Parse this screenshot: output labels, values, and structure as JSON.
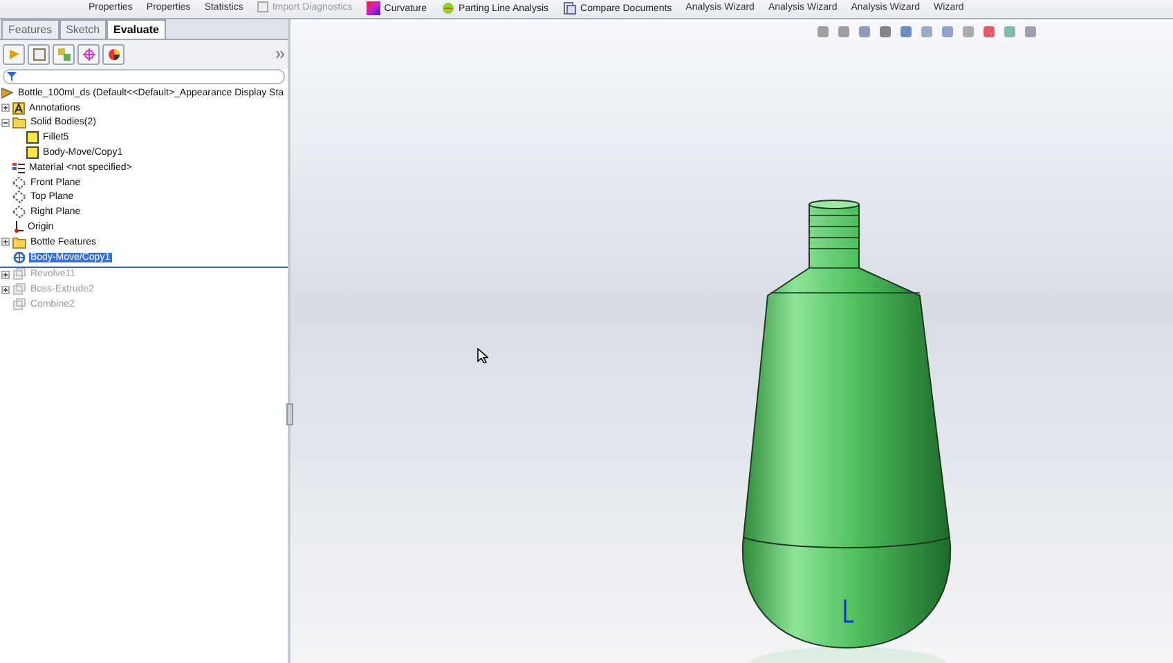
{
  "ribbon": {
    "items": [
      {
        "label": "Properties",
        "kind": "text"
      },
      {
        "label": "Properties",
        "kind": "text"
      },
      {
        "label": "Statistics",
        "kind": "text"
      },
      {
        "label": "Import Diagnostics",
        "kind": "tool",
        "disabled": true
      },
      {
        "label": "Curvature",
        "kind": "tool",
        "disabled": false
      },
      {
        "label": "Parting Line Analysis",
        "kind": "tool",
        "disabled": false
      },
      {
        "label": "Compare Documents",
        "kind": "tool",
        "disabled": false
      },
      {
        "label": "Analysis Wizard",
        "kind": "text"
      },
      {
        "label": "Analysis Wizard",
        "kind": "text"
      },
      {
        "label": "Analysis Wizard",
        "kind": "text"
      },
      {
        "label": "Wizard",
        "kind": "text"
      }
    ]
  },
  "tabs": [
    {
      "label": "Features",
      "selected": false
    },
    {
      "label": "Sketch",
      "selected": false
    },
    {
      "label": "Evaluate",
      "selected": true
    }
  ],
  "tree": {
    "root": "Bottle_100ml_ds  (Default<<Default>_Appearance Display Sta",
    "items": [
      {
        "label": "Annotations",
        "kind": "annotation",
        "expanded": false,
        "selected": false,
        "disabled": false
      },
      {
        "label": "Solid Bodies(2)",
        "kind": "folder",
        "expanded": true,
        "selected": false,
        "disabled": false,
        "children": [
          {
            "label": "Fillet5",
            "kind": "body",
            "selected": false,
            "disabled": false
          },
          {
            "label": "Body-Move/Copy1",
            "kind": "body",
            "selected": false,
            "disabled": false
          }
        ]
      },
      {
        "label": "Material <not specified>",
        "kind": "material",
        "selected": false,
        "disabled": false
      },
      {
        "label": "Front Plane",
        "kind": "plane",
        "selected": false,
        "disabled": false
      },
      {
        "label": "Top Plane",
        "kind": "plane",
        "selected": false,
        "disabled": false
      },
      {
        "label": "Right Plane",
        "kind": "plane",
        "selected": false,
        "disabled": false
      },
      {
        "label": "Origin",
        "kind": "origin",
        "selected": false,
        "disabled": false
      },
      {
        "label": "Bottle Features",
        "kind": "folder",
        "expanded": false,
        "selected": false,
        "disabled": false
      },
      {
        "label": "Body-Move/Copy1",
        "kind": "move",
        "selected": true,
        "disabled": false
      },
      {
        "label": "Revolve11",
        "kind": "feature",
        "expanded": false,
        "selected": false,
        "disabled": true
      },
      {
        "label": "Boss-Extrude2",
        "kind": "feature",
        "expanded": false,
        "selected": false,
        "disabled": true
      },
      {
        "label": "Combine2",
        "kind": "feature",
        "selected": false,
        "disabled": true
      }
    ]
  }
}
